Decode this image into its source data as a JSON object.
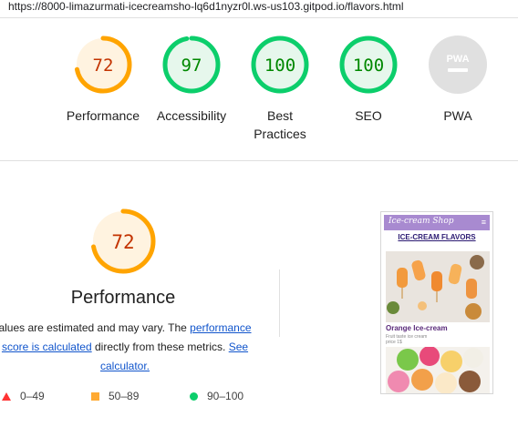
{
  "browser": {
    "url": "https://8000-limazurmati-icecreamsho-lq6d1nyzr0l.ws-us103.gitpod.io/flavors.html"
  },
  "categories": [
    {
      "label": "Performance",
      "score": "72",
      "score_value": 72,
      "rating": "average"
    },
    {
      "label": "Accessibility",
      "score": "97",
      "score_value": 97,
      "rating": "pass"
    },
    {
      "label": "Best Practices",
      "score": "100",
      "score_value": 100,
      "rating": "pass"
    },
    {
      "label": "SEO",
      "score": "100",
      "score_value": 100,
      "rating": "pass"
    },
    {
      "label": "PWA",
      "score": "",
      "score_value": null,
      "rating": "pwa",
      "badge_text": "PWA"
    }
  ],
  "performance": {
    "score": "72",
    "score_value": 72,
    "title": "Performance",
    "desc_prefix": "alues are estimated and may vary. The ",
    "link_performance": "performance score is calculated",
    "desc_middle": " directly from these metrics. ",
    "link_calculator": "See calculator."
  },
  "legend": [
    {
      "shape": "triangle",
      "range": "0–49",
      "color": "#ff3333"
    },
    {
      "shape": "square",
      "range": "50–89",
      "color": "#ffaa33"
    },
    {
      "shape": "circle",
      "range": "90–100",
      "color": "#0cce6b"
    }
  ],
  "thumbnail": {
    "brand": "Ice-cream Shop",
    "heading": "ICE-CREAM FLAVORS",
    "caption": "Orange Ice-cream",
    "small_line_1": "Fruit taste ice cream",
    "small_line_2": "price 1$"
  },
  "colors": {
    "average_stroke": "#ffa400",
    "average_fill": "#fff3e0",
    "average_text": "#c33300",
    "pass_stroke": "#0cce6b",
    "pass_fill": "#e6f7ec",
    "pass_text": "#008800",
    "pwa_fill": "#e0e0e0",
    "thumb_header": "#a88ad0"
  }
}
